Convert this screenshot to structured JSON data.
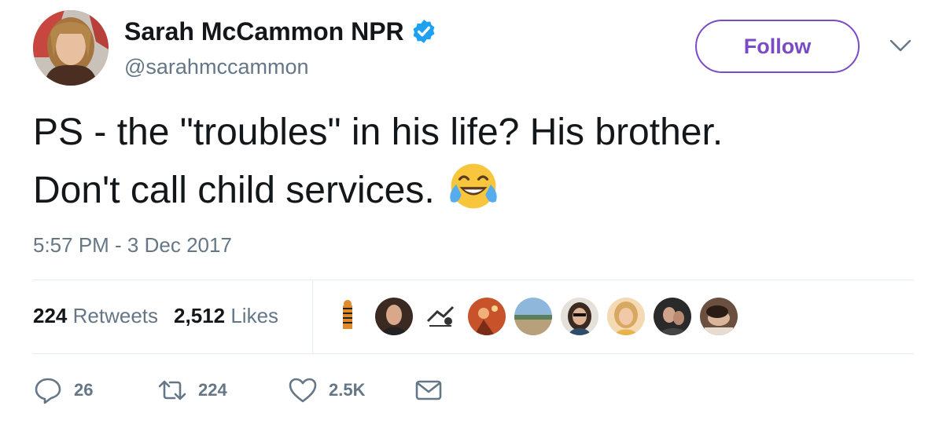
{
  "tweet": {
    "author": {
      "name": "Sarah McCammon NPR",
      "handle": "@sarahmccammon",
      "verified": true
    },
    "follow_label": "Follow",
    "text_line1": "PS - the \"troubles\" in his life? His brother.",
    "text_line2": "Don't call child services.",
    "emoji": "face-with-tears-of-joy-icon",
    "timestamp": "5:57 PM - 3 Dec 2017",
    "stats": {
      "retweets_count": "224",
      "retweets_label": "Retweets",
      "likes_count": "2,512",
      "likes_label": "Likes"
    },
    "actions": {
      "replies": "26",
      "retweets": "224",
      "likes": "2.5K"
    }
  },
  "colors": {
    "accent": "#794bc4",
    "verified": "#1da1f2",
    "muted": "#657786",
    "text": "#14171a",
    "divider": "#e6ecf0"
  }
}
